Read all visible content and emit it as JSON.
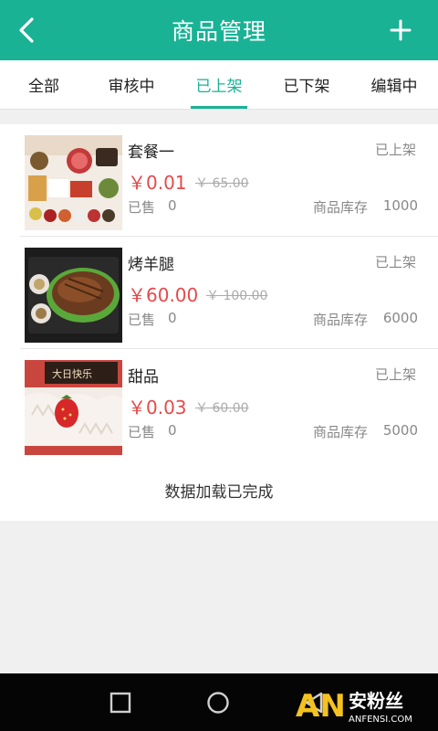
{
  "header": {
    "title": "商品管理",
    "back_icon": "chevron-left-icon",
    "add_icon": "plus-icon"
  },
  "tabs": [
    {
      "label": "全部",
      "active": false
    },
    {
      "label": "审核中",
      "active": false
    },
    {
      "label": "已上架",
      "active": true
    },
    {
      "label": "已下架",
      "active": false
    },
    {
      "label": "编辑中",
      "active": false
    }
  ],
  "products": [
    {
      "name": "套餐一",
      "status": "已上架",
      "price": "￥0.01",
      "original_price": "￥ 65.00",
      "sold_label": "已售",
      "sold": "0",
      "stock_label": "商品库存",
      "stock": "1000"
    },
    {
      "name": "烤羊腿",
      "status": "已上架",
      "price": "￥60.00",
      "original_price": "￥ 100.00",
      "sold_label": "已售",
      "sold": "0",
      "stock_label": "商品库存",
      "stock": "6000"
    },
    {
      "name": "甜品",
      "status": "已上架",
      "price": "￥0.03",
      "original_price": "￥ 60.00",
      "sold_label": "已售",
      "sold": "0",
      "stock_label": "商品库存",
      "stock": "5000"
    }
  ],
  "list_footer": "数据加载已完成",
  "system_nav": {
    "recent_icon": "square-icon",
    "home_icon": "circle-icon",
    "back_icon": "triangle-back-icon"
  },
  "watermark": {
    "brand": "安粉丝",
    "site": "ANFENSI.COM"
  },
  "colors": {
    "accent": "#19b295",
    "price": "#e64a4a",
    "navbar": "#050505"
  }
}
